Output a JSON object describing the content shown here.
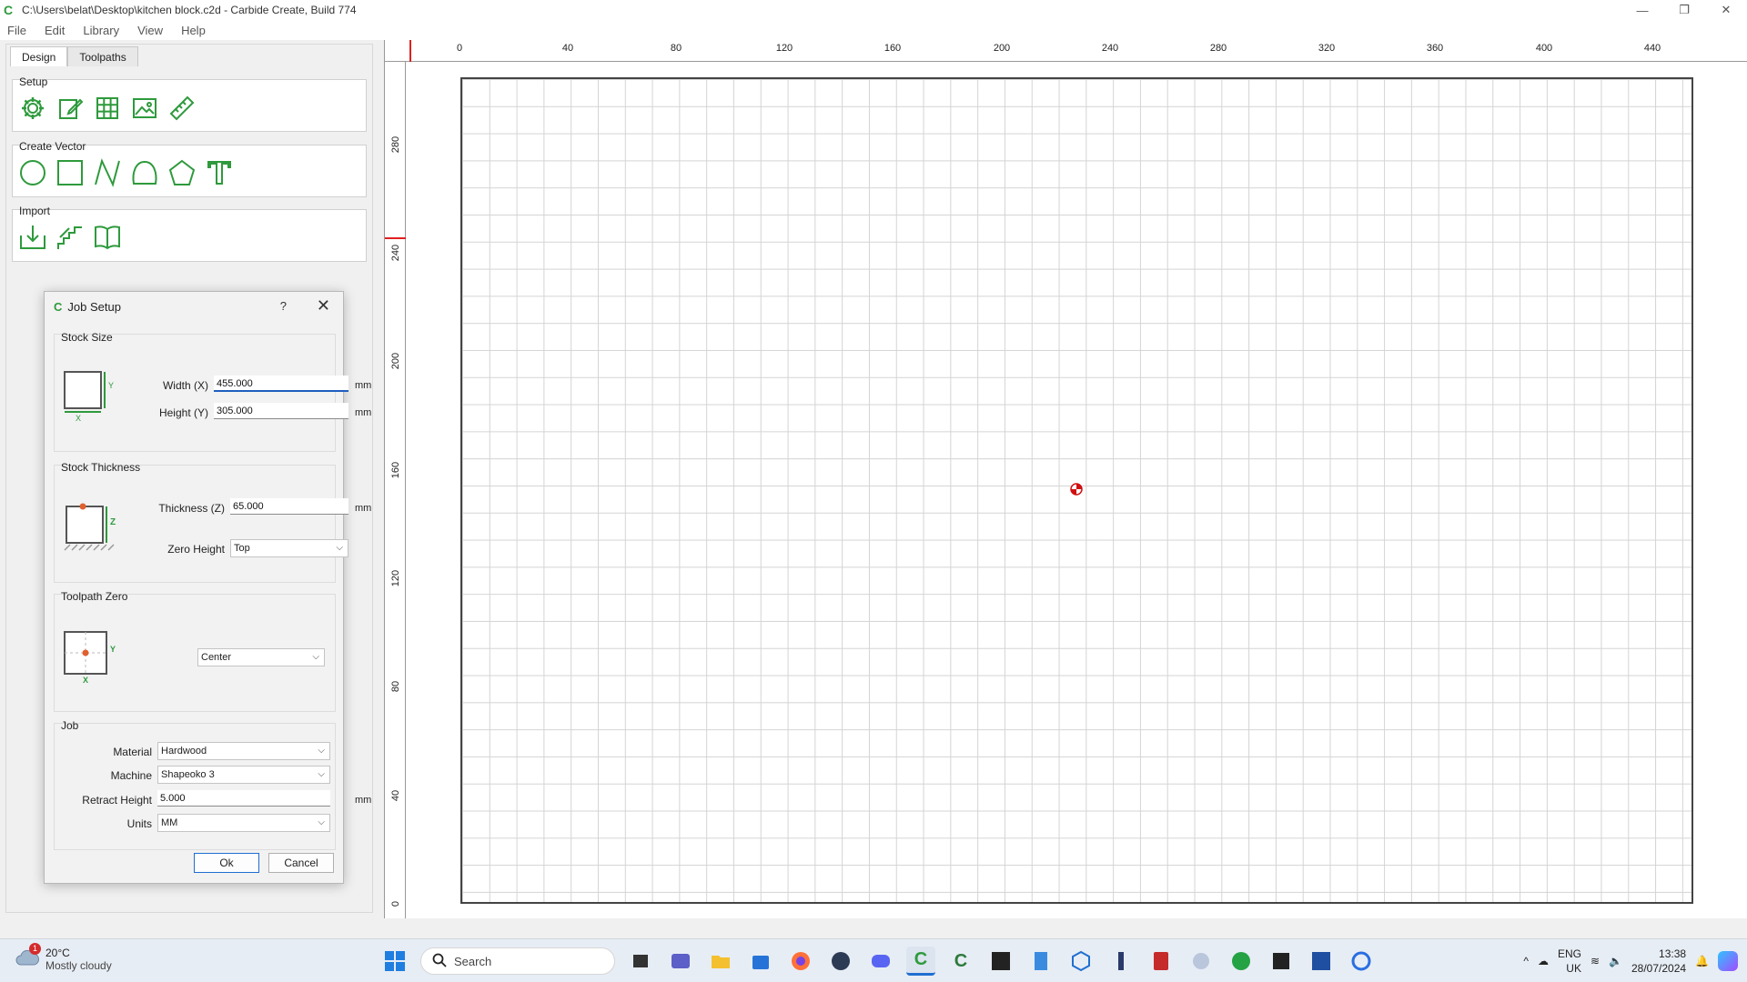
{
  "window": {
    "title": "C:\\Users\\belat\\Desktop\\kitchen block.c2d - Carbide Create, Build 774",
    "minimize": "—",
    "maximize": "❐",
    "close": "✕"
  },
  "menu": [
    "File",
    "Edit",
    "Library",
    "View",
    "Help"
  ],
  "tabs": [
    "Design",
    "Toolpaths"
  ],
  "groups": {
    "setup": "Setup",
    "create_vector": "Create Vector",
    "import": "Import"
  },
  "dialog": {
    "title": "Job Setup",
    "help": "?",
    "close": "✕",
    "stock_size": {
      "label": "Stock Size",
      "width_label": "Width (X)",
      "width_value": "455.000",
      "height_label": "Height (Y)",
      "height_value": "305.000",
      "unit": "mm",
      "axis_x": "X",
      "axis_y": "Y"
    },
    "stock_thickness": {
      "label": "Stock Thickness",
      "thickness_label": "Thickness (Z)",
      "thickness_value": "65.000",
      "unit": "mm",
      "zero_height_label": "Zero Height",
      "zero_height_value": "Top",
      "axis_z": "Z"
    },
    "toolpath_zero": {
      "label": "Toolpath Zero",
      "value": "Center",
      "axis_x": "X",
      "axis_y": "Y"
    },
    "job": {
      "label": "Job",
      "material_label": "Material",
      "material_value": "Hardwood",
      "machine_label": "Machine",
      "machine_value": "Shapeoko 3",
      "retract_label": "Retract Height",
      "retract_value": "5.000",
      "retract_unit": "mm",
      "units_label": "Units",
      "units_value": "MM"
    },
    "ok": "Ok",
    "cancel": "Cancel"
  },
  "rulers": {
    "horizontal": [
      "0",
      "40",
      "80",
      "120",
      "160",
      "200",
      "240",
      "280",
      "320",
      "360",
      "400",
      "440"
    ],
    "vertical": [
      "280",
      "240",
      "200",
      "160",
      "120",
      "80",
      "40",
      "0"
    ]
  },
  "taskbar": {
    "weather_temp": "20°C",
    "weather_desc": "Mostly cloudy",
    "weather_badge": "1",
    "search_placeholder": "Search",
    "lang_top": "ENG",
    "lang_bottom": "UK",
    "time": "13:38",
    "date": "28/07/2024"
  }
}
